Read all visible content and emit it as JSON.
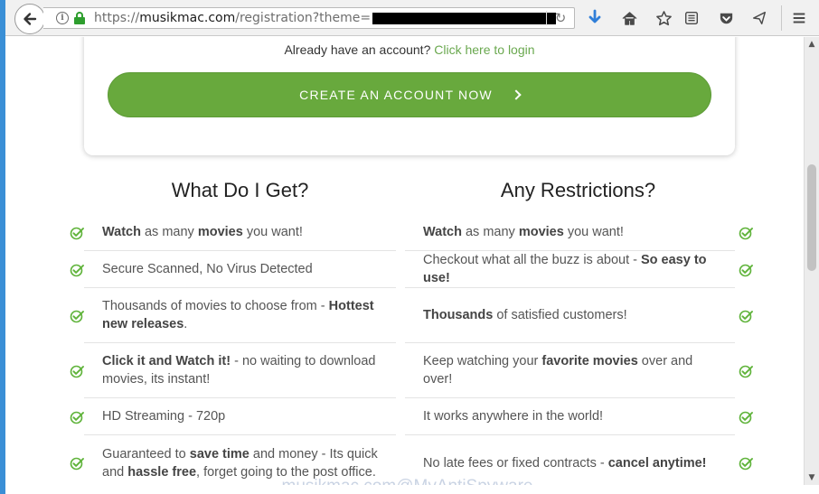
{
  "browser": {
    "url_prefix": "https://",
    "url_host": "musikmac.com",
    "url_path": "/registration?theme="
  },
  "card": {
    "login_prompt": "Already have an account?",
    "login_link": "Click here to login",
    "cta_label": "CREATE AN ACCOUNT NOW"
  },
  "left": {
    "title": "What Do I Get?",
    "items": [
      [
        "<b>Watch</b> as many <b>movies</b> you want!"
      ],
      [
        "Secure Scanned, No Virus Detected"
      ],
      [
        "Thousands of movies to choose from - <b>Hottest new releases</b>."
      ],
      [
        "<b>Click it and Watch it!</b> - no waiting to download movies, its instant!"
      ],
      [
        "HD Streaming - 720p"
      ],
      [
        "Guaranteed to <b>save time</b> and money - Its quick and <b>hassle free</b>, forget going to the post office."
      ]
    ]
  },
  "right": {
    "title": "Any Restrictions?",
    "items": [
      [
        "<b>Watch</b> as many <b>movies</b> you want!"
      ],
      [
        "Checkout what all the buzz is about - <b>So easy to use!</b>"
      ],
      [
        "<b>Thousands</b> of satisfied customers!"
      ],
      [
        "Keep watching your <b>favorite movies</b> over and over!"
      ],
      [
        "It works anywhere in the world!"
      ],
      [
        "No late fees or fixed contracts - <b>cancel anytime!</b>"
      ]
    ]
  },
  "watermark": "musikmac.com@MyAntiSpyware",
  "colors": {
    "accent_green": "#68a93d",
    "link_green": "#6aa84f",
    "check_green": "#5fb33a"
  },
  "icons": [
    "back-arrow-icon",
    "info-icon",
    "lock-icon",
    "reload-icon",
    "download-icon",
    "home-icon",
    "star-icon",
    "reading-list-icon",
    "pocket-icon",
    "send-icon",
    "menu-icon",
    "check-icon",
    "chevron-right-icon"
  ]
}
